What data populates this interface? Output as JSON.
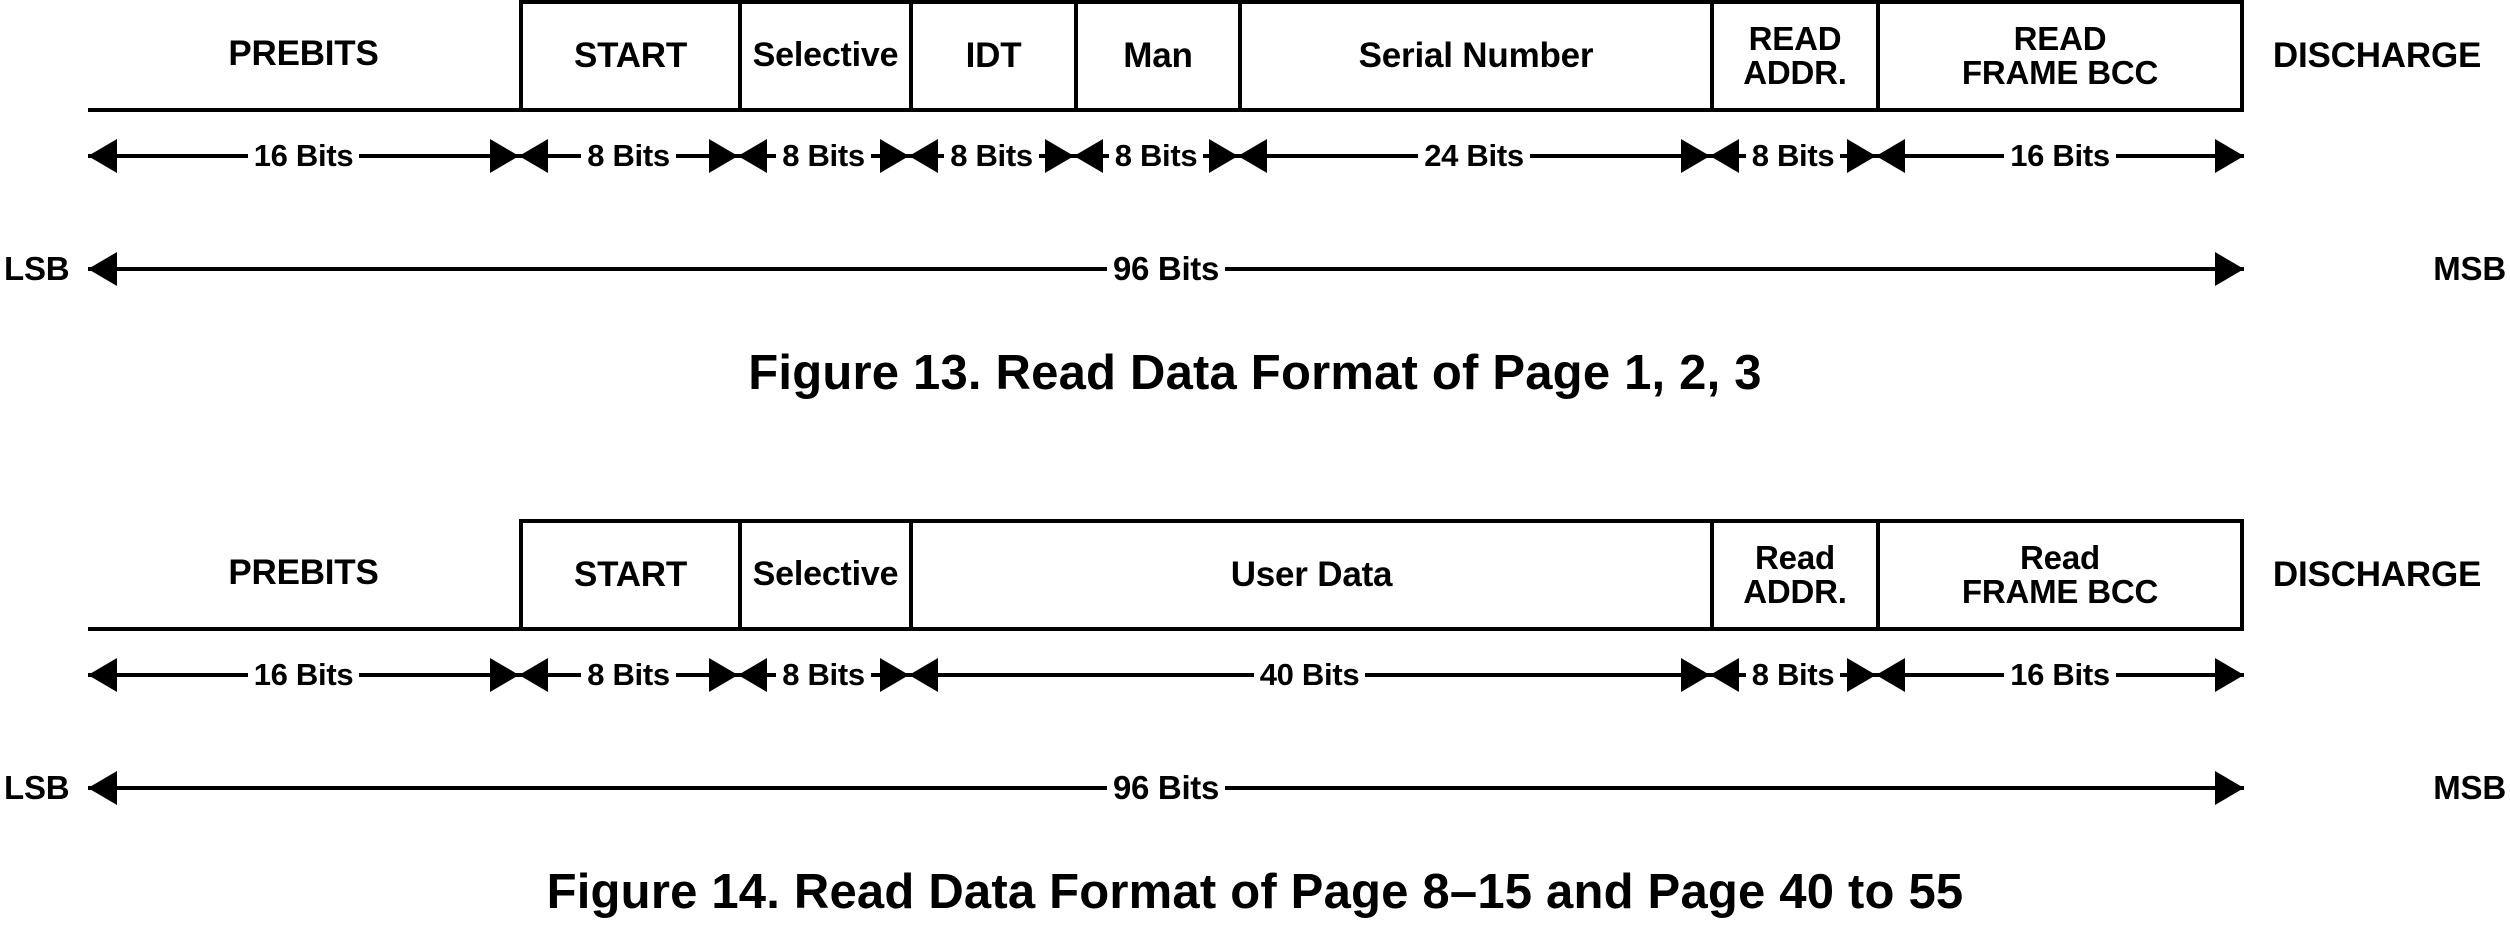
{
  "document": {
    "kind": "datasheet-timing-frame-diagrams",
    "background_color": "#ffffff",
    "line_color": "#000000"
  },
  "figures": [
    {
      "id": "figure-13",
      "caption": "Figure 13.  Read Data Format of Page 1, 2, 3",
      "frame_segments": [
        {
          "name": "prebits",
          "label": "PREBITS",
          "style": "underline",
          "bits": 16
        },
        {
          "name": "start",
          "label": "START",
          "style": "boxed",
          "bits": 8
        },
        {
          "name": "selective",
          "label": "Selective",
          "style": "boxed",
          "bits": 8
        },
        {
          "name": "idt",
          "label": "IDT",
          "style": "boxed",
          "bits": 8
        },
        {
          "name": "man",
          "label": "Man",
          "style": "boxed",
          "bits": 8
        },
        {
          "name": "serial-number",
          "label": "Serial Number",
          "style": "boxed",
          "bits": 24
        },
        {
          "name": "read-addr",
          "label": "READ\nADDR.",
          "style": "boxed",
          "bits": 8
        },
        {
          "name": "read-frame-bcc",
          "label": "READ\nFRAME BCC",
          "style": "boxed",
          "bits": 16
        },
        {
          "name": "discharge",
          "label": "DISCHARGE",
          "style": "plain",
          "bits": null
        }
      ],
      "bit_measures": [
        {
          "name": "measure-prebits",
          "label": "16 Bits"
        },
        {
          "name": "measure-start",
          "label": "8 Bits"
        },
        {
          "name": "measure-selective",
          "label": "8 Bits"
        },
        {
          "name": "measure-idt",
          "label": "8 Bits"
        },
        {
          "name": "measure-man",
          "label": "8 Bits"
        },
        {
          "name": "measure-serial-number",
          "label": "24 Bits"
        },
        {
          "name": "measure-read-addr",
          "label": "8 Bits"
        },
        {
          "name": "measure-read-frame-bcc",
          "label": "16 Bits"
        }
      ],
      "total": {
        "left_label": "LSB",
        "right_label": "MSB",
        "label": "96 Bits"
      }
    },
    {
      "id": "figure-14",
      "caption": "Figure 14.  Read Data Format of Page 8–15 and Page 40 to 55",
      "frame_segments": [
        {
          "name": "prebits",
          "label": "PREBITS",
          "style": "underline",
          "bits": 16
        },
        {
          "name": "start",
          "label": "START",
          "style": "boxed",
          "bits": 8
        },
        {
          "name": "selective",
          "label": "Selective",
          "style": "boxed",
          "bits": 8
        },
        {
          "name": "user-data",
          "label": "User Data",
          "style": "boxed",
          "bits": 40
        },
        {
          "name": "read-addr",
          "label": "Read\nADDR.",
          "style": "boxed",
          "bits": 8
        },
        {
          "name": "read-frame-bcc",
          "label": "Read\nFRAME BCC",
          "style": "boxed",
          "bits": 16
        },
        {
          "name": "discharge",
          "label": "DISCHARGE",
          "style": "plain",
          "bits": null
        }
      ],
      "bit_measures": [
        {
          "name": "measure-prebits",
          "label": "16 Bits"
        },
        {
          "name": "measure-start",
          "label": "8 Bits"
        },
        {
          "name": "measure-selective",
          "label": "8 Bits"
        },
        {
          "name": "measure-user-data",
          "label": "40 Bits"
        },
        {
          "name": "measure-read-addr",
          "label": "8 Bits"
        },
        {
          "name": "measure-read-frame-bcc",
          "label": "16 Bits"
        }
      ],
      "total": {
        "left_label": "LSB",
        "right_label": "MSB",
        "label": "96 Bits"
      }
    }
  ]
}
